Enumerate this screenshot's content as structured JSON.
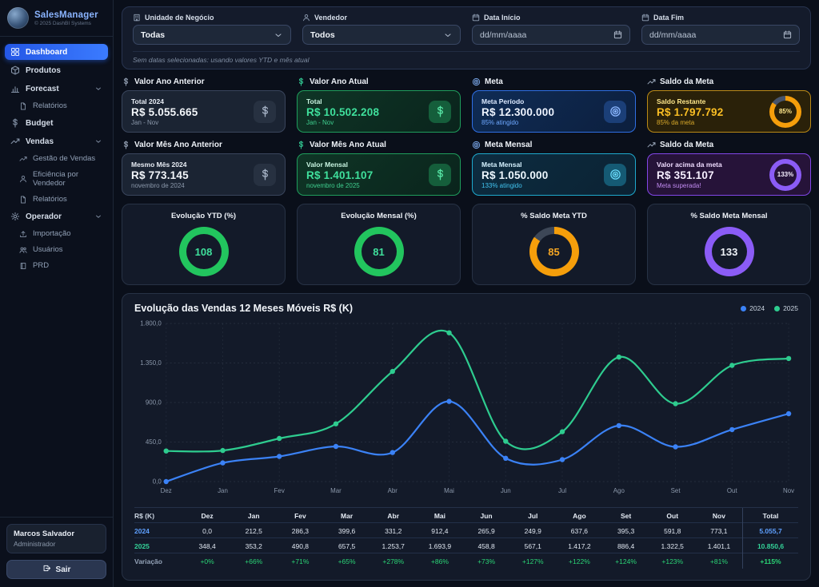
{
  "app": {
    "name": "SalesManager",
    "copyright": "© 2025 DashBI Systems"
  },
  "sidebar": {
    "items": [
      {
        "id": "dashboard",
        "label": "Dashboard",
        "icon": "grid",
        "active": true
      },
      {
        "id": "produtos",
        "label": "Produtos",
        "icon": "package"
      },
      {
        "id": "forecast",
        "label": "Forecast",
        "icon": "bar-chart",
        "chevron": true
      },
      {
        "id": "forecast-relatorios",
        "label": "Relatórios",
        "icon": "document",
        "sub": true
      },
      {
        "id": "budget",
        "label": "Budget",
        "icon": "dollar"
      },
      {
        "id": "vendas",
        "label": "Vendas",
        "icon": "trending-up",
        "chevron": true
      },
      {
        "id": "gestao-de-vendas",
        "label": "Gestão de Vendas",
        "icon": "trending-up",
        "sub": true
      },
      {
        "id": "eficiencia-por-vendedor",
        "label": "Eficiência por Vendedor",
        "icon": "user",
        "sub": true
      },
      {
        "id": "vendas-relatorios",
        "label": "Relatórios",
        "icon": "document",
        "sub": true
      },
      {
        "id": "operador",
        "label": "Operador",
        "icon": "gear",
        "chevron": true
      },
      {
        "id": "importacao",
        "label": "Importação",
        "icon": "upload",
        "sub": true
      },
      {
        "id": "usuarios",
        "label": "Usuários",
        "icon": "users",
        "sub": true
      },
      {
        "id": "prd",
        "label": "PRD",
        "icon": "book",
        "sub": true
      }
    ],
    "user": {
      "name": "Marcos Salvador",
      "role": "Administrador"
    },
    "logout_label": "Sair"
  },
  "filters": {
    "fields": [
      {
        "id": "unidade-de-negocio",
        "label": "Unidade de Negócio",
        "icon": "building",
        "type": "select",
        "value": "Todas"
      },
      {
        "id": "vendedor",
        "label": "Vendedor",
        "icon": "user",
        "type": "select",
        "value": "Todos"
      },
      {
        "id": "data-inicio",
        "label": "Data Início",
        "icon": "calendar",
        "type": "date",
        "value": "dd/mm/aaaa"
      },
      {
        "id": "data-fim",
        "label": "Data Fim",
        "icon": "calendar",
        "type": "date",
        "value": "dd/mm/aaaa"
      }
    ],
    "note": "Sem datas selecionadas: usando valores YTD e mês atual"
  },
  "kpis": [
    {
      "header": "Valor Ano Anterior",
      "header_icon": "dollar",
      "theme": "gray",
      "title": "Total 2024",
      "value": "R$ 5.055.665",
      "subtitle": "Jan - Nov",
      "badge": "dollar"
    },
    {
      "header": "Valor Ano Atual",
      "header_icon": "dollar",
      "theme": "green",
      "title": "Total",
      "value": "R$ 10.502.208",
      "subtitle": "Jan - Nov",
      "badge": "dollar"
    },
    {
      "header": "Meta",
      "header_icon": "target",
      "theme": "blue",
      "title": "Meta Período",
      "value": "R$ 12.300.000",
      "subtitle": "85% atingido",
      "badge": "target"
    },
    {
      "header": "Saldo da Meta",
      "header_icon": "trending-up",
      "theme": "amber",
      "title": "Saldo Restante",
      "value": "R$ 1.797.792",
      "subtitle": "85% da meta",
      "donut": {
        "pct": 85,
        "label": "85%",
        "color": "#f59e0b",
        "track": "#46536b",
        "text_color": "#fde68a"
      }
    },
    {
      "header": "Valor Mês Ano Anterior",
      "header_icon": "dollar",
      "theme": "gray",
      "title": "Mesmo Mês 2024",
      "value": "R$ 773.145",
      "subtitle": "novembro de 2024",
      "badge": "dollar"
    },
    {
      "header": "Valor Mês Ano Atual",
      "header_icon": "dollar",
      "theme": "green",
      "title": "Valor Mensal",
      "value": "R$ 1.401.107",
      "subtitle": "novembro de 2025",
      "badge": "dollar"
    },
    {
      "header": "Meta Mensal",
      "header_icon": "target",
      "theme": "cyan",
      "title": "Meta Mensal",
      "value": "R$ 1.050.000",
      "subtitle": "133% atingido",
      "badge": "target"
    },
    {
      "header": "Saldo da Meta",
      "header_icon": "trending-up",
      "theme": "purple",
      "title": "Valor acima da meta",
      "value": "R$ 351.107",
      "subtitle": "Meta superada!",
      "donut": {
        "pct": 100,
        "label": "133%",
        "color": "#8b5cf6",
        "track": "#8b5cf6",
        "text_color": "#f6efff"
      }
    }
  ],
  "gauges": [
    {
      "title": "Evolução YTD (%)",
      "value": "108",
      "pct": 100,
      "color": "#22c55e",
      "track": "#22c55e",
      "text_color": "#3fe09c"
    },
    {
      "title": "Evolução Mensal (%)",
      "value": "81",
      "pct": 100,
      "color": "#22c55e",
      "track": "#22c55e",
      "text_color": "#3fe09c"
    },
    {
      "title": "% Saldo Meta YTD",
      "value": "85",
      "pct": 85,
      "color": "#f59e0b",
      "track": "#3d4757",
      "text_color": "#f5a623"
    },
    {
      "title": "% Saldo Meta Mensal",
      "value": "133",
      "pct": 100,
      "color": "#8b5cf6",
      "track": "#8b5cf6",
      "text_color": "#eef2f8"
    }
  ],
  "chart_data": {
    "type": "line",
    "title": "Evolução das Vendas 12 Meses Móveis R$ (K)",
    "categories": [
      "Dez",
      "Jan",
      "Fev",
      "Mar",
      "Abr",
      "Mai",
      "Jun",
      "Jul",
      "Ago",
      "Set",
      "Out",
      "Nov"
    ],
    "series": [
      {
        "name": "2024",
        "color": "#3b82f6",
        "values": [
          0.0,
          212.5,
          286.3,
          399.6,
          331.2,
          912.4,
          265.9,
          249.9,
          637.6,
          395.3,
          591.8,
          773.1
        ]
      },
      {
        "name": "2025",
        "color": "#2ecc8f",
        "values": [
          348.4,
          353.2,
          490.8,
          657.5,
          1253.7,
          1693.9,
          458.8,
          567.1,
          1417.2,
          886.4,
          1322.5,
          1401.1
        ]
      }
    ],
    "ylim": [
      0,
      1800
    ],
    "yticks": [
      {
        "v": 0,
        "label": "0,0"
      },
      {
        "v": 450,
        "label": "450,0"
      },
      {
        "v": 900,
        "label": "900,0"
      },
      {
        "v": 1350,
        "label": "1.350,0"
      },
      {
        "v": 1800,
        "label": "1.800,0"
      }
    ],
    "grid": true,
    "legend_position": "top-right"
  },
  "table": {
    "corner": "R$ (K)",
    "columns": [
      "Dez",
      "Jan",
      "Fev",
      "Mar",
      "Abr",
      "Mai",
      "Jun",
      "Jul",
      "Ago",
      "Set",
      "Out",
      "Nov",
      "Total"
    ],
    "rows": [
      {
        "label": "2024",
        "label_color": "#5ea0ff",
        "cell_color": "#dfe6f0",
        "cells": [
          "0,0",
          "212,5",
          "286,3",
          "399,6",
          "331,2",
          "912,4",
          "265,9",
          "249,9",
          "637,6",
          "395,3",
          "591,8",
          "773,1"
        ],
        "total": "5.055,7",
        "total_color": "#5ea0ff"
      },
      {
        "label": "2025",
        "label_color": "#34d399",
        "cell_color": "#dfe6f0",
        "cells": [
          "348,4",
          "353,2",
          "490,8",
          "657,5",
          "1.253,7",
          "1.693,9",
          "458,8",
          "567,1",
          "1.417,2",
          "886,4",
          "1.322,5",
          "1.401,1"
        ],
        "total": "10.850,6",
        "total_color": "#34d399"
      },
      {
        "label": "Variação",
        "label_color": "#94a3b8",
        "cell_color": "#2bd576",
        "cells": [
          "+0%",
          "+66%",
          "+71%",
          "+65%",
          "+278%",
          "+86%",
          "+73%",
          "+127%",
          "+122%",
          "+124%",
          "+123%",
          "+81%"
        ],
        "total": "+115%",
        "total_color": "#2bd576"
      }
    ]
  }
}
